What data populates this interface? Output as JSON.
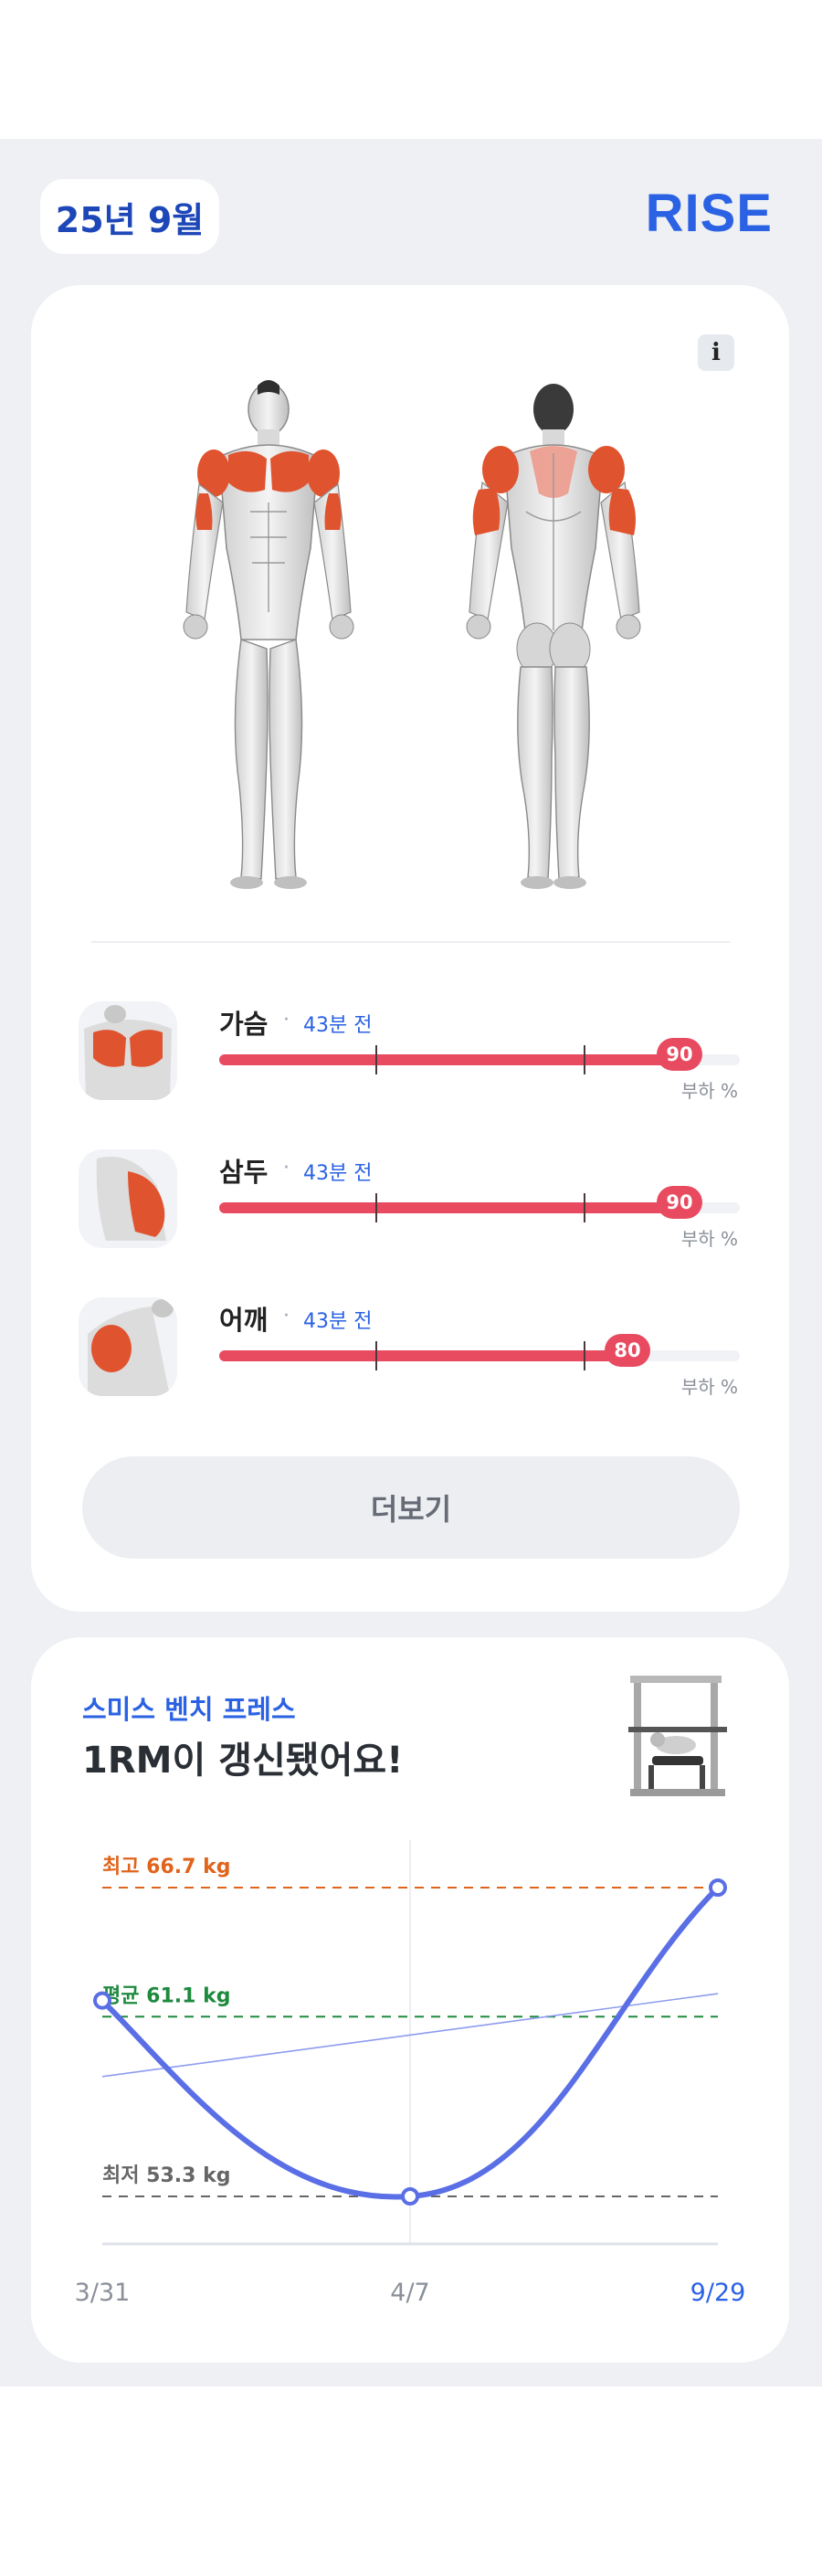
{
  "header": {
    "month": "25년 9월",
    "brand": "RISE"
  },
  "card": {
    "info_label": "i",
    "more_label": "더보기"
  },
  "muscles": [
    {
      "name": "가슴",
      "time": "43분 전",
      "load": 90,
      "unit": "부하 %"
    },
    {
      "name": "삼두",
      "time": "43분 전",
      "load": 90,
      "unit": "부하 %"
    },
    {
      "name": "어깨",
      "time": "43분 전",
      "load": 80,
      "unit": "부하 %"
    }
  ],
  "record": {
    "exercise": "스미스 벤치 프레스",
    "headline": "1RM이 갱신됐어요!"
  },
  "chart_data": {
    "type": "line",
    "x": [
      "3/31",
      "4/7",
      "9/29"
    ],
    "series": [
      {
        "values": [
          61.8,
          53.3,
          66.7
        ],
        "color": "#5a6ee6"
      }
    ],
    "reference_lines": [
      {
        "label": "최고 66.7 kg",
        "value": 66.7,
        "color": "#e0641c"
      },
      {
        "label": "평균 61.1 kg",
        "value": 61.1,
        "color": "#1e8a3e"
      },
      {
        "label": "최저 53.3 kg",
        "value": 53.3,
        "color": "#666666"
      }
    ],
    "trendline": {
      "start": 58.5,
      "end": 62.1,
      "color": "#8d9bf0"
    },
    "xlabels": [
      "3/31",
      "4/7",
      "9/29"
    ],
    "grid": false
  },
  "colors": {
    "accent": "#2b62e3",
    "load": "#e84a5f",
    "background": "#eef0f4"
  }
}
